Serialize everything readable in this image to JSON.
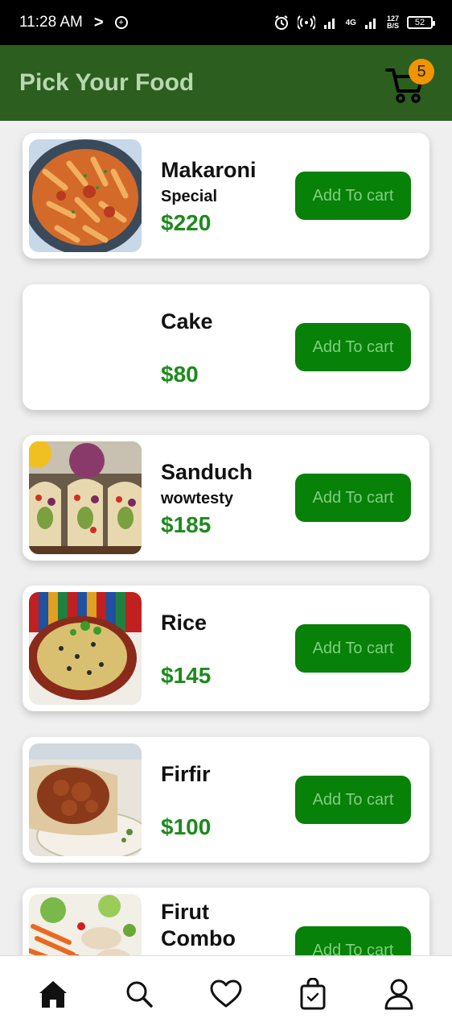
{
  "status_bar": {
    "time": "11:28 AM",
    "network_gen": "4G",
    "net_speed_top": "127",
    "net_speed_bottom": "B/S",
    "battery": "52"
  },
  "app_bar": {
    "title": "Pick Your Food",
    "cart_count": "5"
  },
  "products": [
    {
      "name": "Makaroni",
      "desc": "Special",
      "price": "$220",
      "button": "Add To cart",
      "image": "pasta-image"
    },
    {
      "name": "Cake",
      "desc": "",
      "price": "$80",
      "button": "Add To cart",
      "image": ""
    },
    {
      "name": "Sanduch",
      "desc": "wowtesty",
      "price": "$185",
      "button": "Add To cart",
      "image": "tacos-image"
    },
    {
      "name": "Rice",
      "desc": "",
      "price": "$145",
      "button": "Add To cart",
      "image": "rice-image"
    },
    {
      "name": "Firfir",
      "desc": "",
      "price": "$100",
      "button": "Add To cart",
      "image": "firfir-image"
    },
    {
      "name": "Firut Combo",
      "desc": "",
      "price": "",
      "button": "Add To cart",
      "image": "salad-image"
    }
  ],
  "bottom_nav": {
    "items": [
      "home-icon",
      "search-icon",
      "heart-icon",
      "shopping-bag-icon",
      "user-icon"
    ]
  }
}
